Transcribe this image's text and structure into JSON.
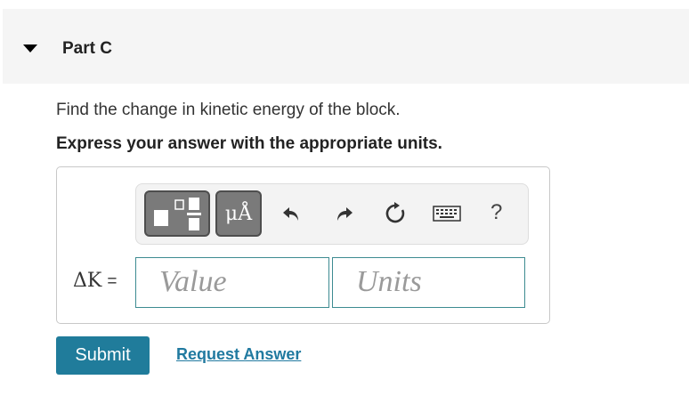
{
  "part": {
    "title": "Part C",
    "expanded": true
  },
  "question": {
    "text": "Find the change in kinetic energy of the block.",
    "instruction": "Express your answer with the appropriate units."
  },
  "toolbar": {
    "units_label": "μÅ",
    "help_label": "?",
    "icons": [
      "templates-icon",
      "units-icon",
      "undo-icon",
      "redo-icon",
      "reset-icon",
      "keyboard-icon",
      "help-icon"
    ]
  },
  "answer": {
    "variable_label": "ΔK",
    "equals": "=",
    "value_placeholder": "Value",
    "units_placeholder": "Units",
    "value": "",
    "units": ""
  },
  "actions": {
    "submit_label": "Submit",
    "request_label": "Request Answer"
  },
  "colors": {
    "accent": "#207c9b",
    "link": "#217aa0",
    "field_border": "#3d8b91"
  }
}
